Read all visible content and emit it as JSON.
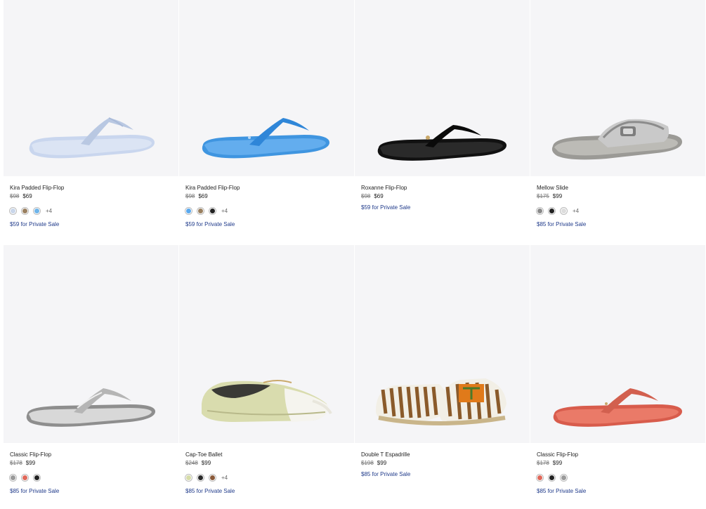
{
  "products": [
    {
      "name": "Kira Padded Flip-Flop",
      "original_price": "$98",
      "sale_price": "$69",
      "swatches": [
        "#c9d6ea",
        "#9a8060",
        "#6fb5ea"
      ],
      "more": "+4",
      "private": "$59 for Private Sale",
      "image": "white-flip-flop"
    },
    {
      "name": "Kira Padded Flip-Flop",
      "original_price": "$98",
      "sale_price": "$69",
      "swatches": [
        "#5aa9ee",
        "#9a8060",
        "#222222"
      ],
      "more": "+4",
      "private": "$59 for Private Sale",
      "image": "blue-flip-flop"
    },
    {
      "name": "Roxanne Flip-Flop",
      "original_price": "$98",
      "sale_price": "$69",
      "swatches": [],
      "more": "",
      "private": "$59 for Private Sale",
      "image": "black-flip-flop"
    },
    {
      "name": "Mellow Slide",
      "original_price": "$175",
      "sale_price": "$99",
      "swatches": [
        "#8a8a8a",
        "#222222",
        "#dddddd"
      ],
      "more": "+4",
      "private": "$85 for Private Sale",
      "image": "silver-slide"
    },
    {
      "name": "Classic Flip-Flop",
      "original_price": "$178",
      "sale_price": "$99",
      "swatches": [
        "#9a9a9a",
        "#e0685a",
        "#222222"
      ],
      "more": "",
      "private": "$85 for Private Sale",
      "image": "silver-flip-flop"
    },
    {
      "name": "Cap-Toe Ballet",
      "original_price": "$248",
      "sale_price": "$99",
      "swatches": [
        "#d6dca8",
        "#2a2a2a",
        "#8a5a3a"
      ],
      "more": "+4",
      "private": "$85 for Private Sale",
      "image": "ballet-flat"
    },
    {
      "name": "Double T Espadrille",
      "original_price": "$198",
      "sale_price": "$99",
      "swatches": [],
      "more": "",
      "private": "$85 for Private Sale",
      "image": "espadrille"
    },
    {
      "name": "Classic Flip-Flop",
      "original_price": "$178",
      "sale_price": "$99",
      "swatches": [
        "#e0685a",
        "#222222",
        "#9a9a9a"
      ],
      "more": "",
      "private": "$85 for Private Sale",
      "image": "coral-flip-flop"
    }
  ]
}
